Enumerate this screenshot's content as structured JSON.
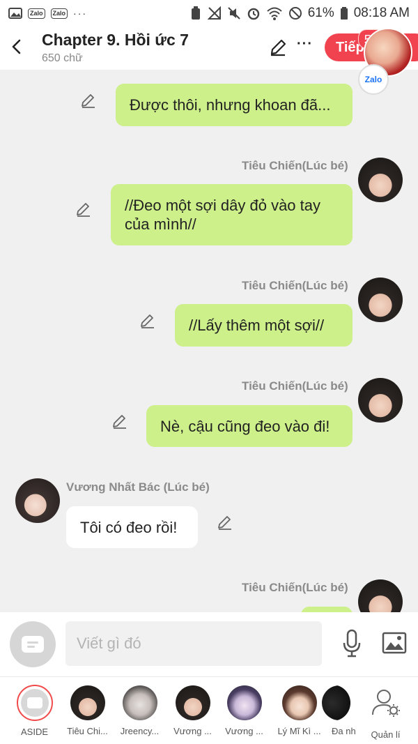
{
  "status_bar": {
    "app_icons": [
      "Zalo",
      "Zalo"
    ],
    "dots": "···",
    "battery": "61%",
    "time": "08:18 AM"
  },
  "header": {
    "title": "Chapter 9. Hồi ức 7",
    "subtitle": "650 chữ",
    "next_label": "Tiếp",
    "badge": "5+",
    "chathead_app": "Zalo"
  },
  "messages": [
    {
      "side": "right",
      "speaker": "",
      "text": "Được thôi, nhưng khoan đã..."
    },
    {
      "side": "right",
      "speaker": "Tiêu Chiến(Lúc bé)",
      "text": "//Đeo một sợi dây đỏ vào tay của mình//"
    },
    {
      "side": "right",
      "speaker": "Tiêu Chiến(Lúc bé)",
      "text": "//Lấy thêm một sợi//"
    },
    {
      "side": "right",
      "speaker": "Tiêu Chiến(Lúc bé)",
      "text": "Nè, cậu cũng đeo vào đi!"
    },
    {
      "side": "left",
      "speaker": "Vương Nhất Bác (Lúc bé)",
      "text": "Tôi có đeo rồi!"
    },
    {
      "side": "right",
      "speaker": "Tiêu Chiến(Lúc bé)",
      "text": ""
    }
  ],
  "composer": {
    "placeholder": "Viết gì đó"
  },
  "characters": [
    {
      "label": "ASIDE"
    },
    {
      "label": "Tiêu Chi..."
    },
    {
      "label": "Jreency..."
    },
    {
      "label": "Vương ..."
    },
    {
      "label": "Vương ..."
    },
    {
      "label": "Lý Mĩ Kì ..."
    },
    {
      "label": "Đa nh"
    },
    {
      "label": "Quản lí"
    }
  ],
  "colors": {
    "accent": "#f0434f",
    "bubble_right": "#cdf08a",
    "bubble_left": "#ffffff",
    "background": "#f0f0f0"
  }
}
